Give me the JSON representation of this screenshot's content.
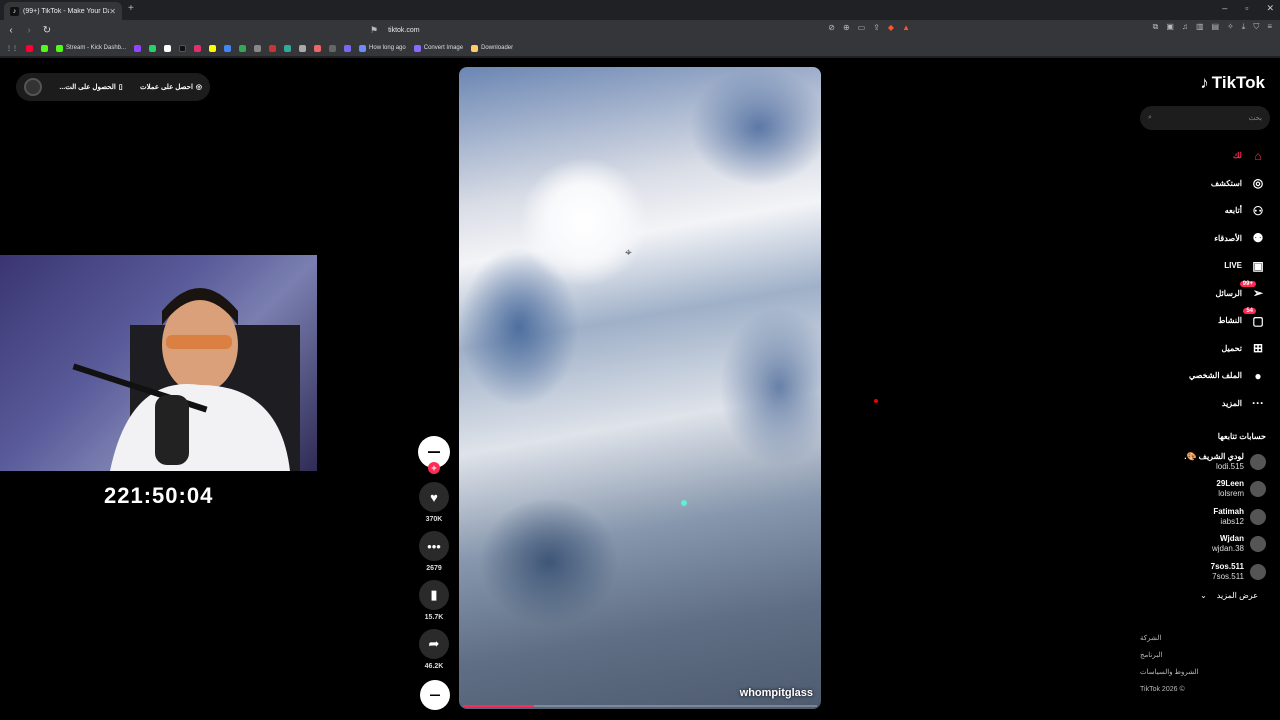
{
  "browser": {
    "tab_title": "(99+) TikTok - Make Your Day",
    "url": "tiktok.com",
    "bookmarks": [
      {
        "label": "",
        "color": "#ff0033"
      },
      {
        "label": "",
        "color": "#53fc18"
      },
      {
        "label": "Stream - Kick Dashb...",
        "color": "#53fc18"
      },
      {
        "label": "",
        "color": "#9146ff"
      },
      {
        "label": "",
        "color": "#25d366"
      },
      {
        "label": "",
        "color": "#ffffff"
      },
      {
        "label": "",
        "color": "#000000"
      },
      {
        "label": "",
        "color": "#e1306c"
      },
      {
        "label": "",
        "color": "#fffc00"
      },
      {
        "label": "",
        "color": "#4285f4"
      },
      {
        "label": "",
        "color": "#34a853"
      },
      {
        "label": "How long ago",
        "color": "#6b8cff"
      },
      {
        "label": "Convert Image",
        "color": "#8a6bff"
      },
      {
        "label": "Downloader",
        "color": "#ffcc66"
      }
    ]
  },
  "promo": {
    "coins": "احصل على عملات",
    "app": "الحصول على الت..."
  },
  "stream": {
    "timer": "221:50:04"
  },
  "video": {
    "author": "whompitglass",
    "progress": 0.2
  },
  "actions": {
    "likes": "370K",
    "comments": "2679",
    "saves": "15.7K",
    "shares": "46.2K"
  },
  "sidebar": {
    "logo": "TikTok",
    "search_placeholder": "بحث",
    "nav": [
      {
        "label": "لك",
        "icon": "home-icon",
        "glyph": "⌂",
        "active": true
      },
      {
        "label": "استكشف",
        "icon": "compass-icon",
        "glyph": "◎"
      },
      {
        "label": "أتابعه",
        "icon": "user-follow-icon",
        "glyph": "⚇"
      },
      {
        "label": "الأصدقاء",
        "icon": "friends-icon",
        "glyph": "⚉"
      },
      {
        "label": "LIVE",
        "icon": "live-icon",
        "glyph": "▣"
      },
      {
        "label": "الرسائل",
        "icon": "messages-icon",
        "glyph": "➢",
        "badge": "+99"
      },
      {
        "label": "النشاط",
        "icon": "activity-icon",
        "glyph": "▢",
        "badge": "54"
      },
      {
        "label": "تحميل",
        "icon": "upload-icon",
        "glyph": "⊞"
      },
      {
        "label": "الملف الشخصي",
        "icon": "profile-icon",
        "glyph": "●"
      },
      {
        "label": "المزيد",
        "icon": "more-icon",
        "glyph": "···"
      }
    ],
    "following_title": "حسابات تتابعها",
    "following": [
      {
        "name": "لودي الشريف 🎨.",
        "user": "lodi.515"
      },
      {
        "name": "29Leen",
        "user": "lolsrem"
      },
      {
        "name": "Fatimah",
        "user": "iabs12"
      },
      {
        "name": "Wjdan",
        "user": "wjdan.38"
      },
      {
        "name": "7sos.511",
        "user": "7sos.511"
      }
    ],
    "see_more": "عرض المزيد",
    "footer": [
      "الشركة",
      "البرنامج",
      "الشروط والسياسات",
      "© 2026 TikTok"
    ]
  }
}
